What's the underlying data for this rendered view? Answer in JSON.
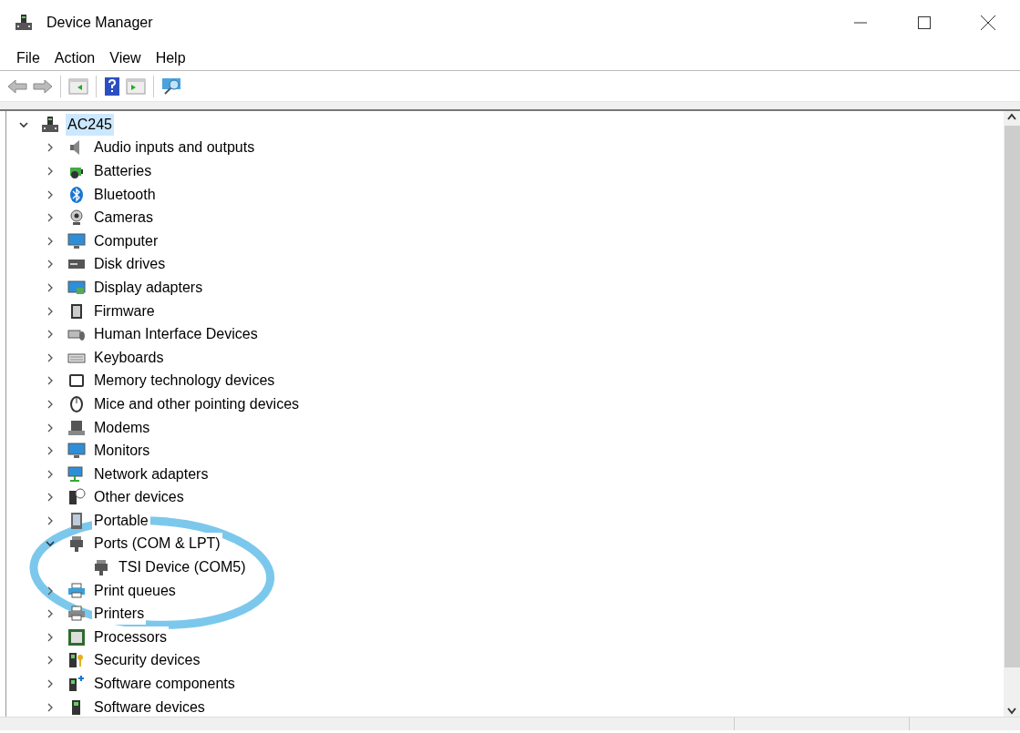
{
  "window": {
    "title": "Device Manager"
  },
  "menu": [
    "File",
    "Action",
    "View",
    "Help"
  ],
  "tree": {
    "label": "AC245",
    "expanded": true,
    "selected": true,
    "children": [
      {
        "label": "Audio inputs and outputs",
        "expanded": false,
        "selected": false
      },
      {
        "label": "Batteries",
        "expanded": false,
        "selected": false
      },
      {
        "label": "Bluetooth",
        "expanded": false,
        "selected": false
      },
      {
        "label": "Cameras",
        "expanded": false,
        "selected": false
      },
      {
        "label": "Computer",
        "expanded": false,
        "selected": false
      },
      {
        "label": "Disk drives",
        "expanded": false,
        "selected": false
      },
      {
        "label": "Display adapters",
        "expanded": false,
        "selected": false
      },
      {
        "label": "Firmware",
        "expanded": false,
        "selected": false
      },
      {
        "label": "Human Interface Devices",
        "expanded": false,
        "selected": false
      },
      {
        "label": "Keyboards",
        "expanded": false,
        "selected": false
      },
      {
        "label": "Memory technology devices",
        "expanded": false,
        "selected": false
      },
      {
        "label": "Mice and other pointing devices",
        "expanded": false,
        "selected": false
      },
      {
        "label": "Modems",
        "expanded": false,
        "selected": false
      },
      {
        "label": "Monitors",
        "expanded": false,
        "selected": false
      },
      {
        "label": "Network adapters",
        "expanded": false,
        "selected": false
      },
      {
        "label": "Other devices",
        "expanded": false,
        "selected": false
      },
      {
        "label": "Portable",
        "expanded": false,
        "selected": false
      },
      {
        "label": "Ports (COM & LPT)",
        "expanded": true,
        "selected": false,
        "children": [
          {
            "label": "TSI Device (COM5)",
            "selected": false
          }
        ]
      },
      {
        "label": "Print queues",
        "expanded": false,
        "selected": false
      },
      {
        "label": "Printers",
        "expanded": false,
        "selected": false
      },
      {
        "label": "Processors",
        "expanded": false,
        "selected": false
      },
      {
        "label": "Security devices",
        "expanded": false,
        "selected": false
      },
      {
        "label": "Software components",
        "expanded": false,
        "selected": false
      },
      {
        "label": "Software devices",
        "expanded": false,
        "selected": false
      }
    ]
  }
}
